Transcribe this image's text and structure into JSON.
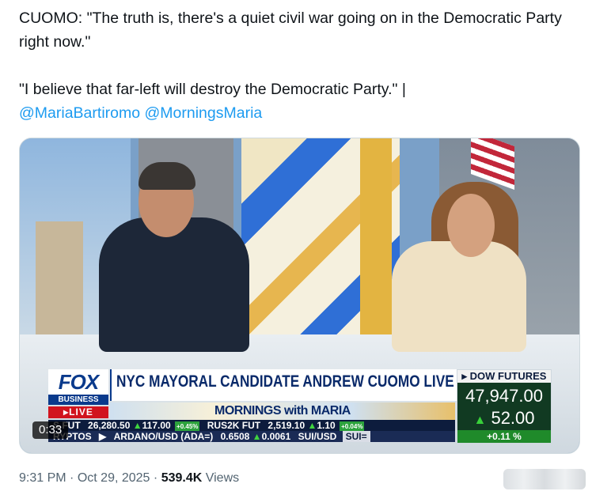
{
  "tweet": {
    "line1": "CUOMO: \"The truth is, there's a quiet civil war going on in the Democratic Party right now.\"",
    "line2_text": "\"I believe that far-left will destroy the Democratic Party.\" |",
    "mention1": "@MariaBartiromo",
    "mention2": "@MorningsMaria"
  },
  "video": {
    "timestamp": "0:33",
    "logo": {
      "fox": "FOX",
      "business": "BUSINESS",
      "live": "LIVE"
    },
    "headline": "NYC MAYORAL CANDIDATE ANDREW CUOMO LIVE ON MWM",
    "show_title": "MORNINGS with MARIA",
    "ticker_row1": [
      {
        "label": "S FUT",
        "value": "26,280.50",
        "change": "117.00",
        "pct": "+0.45%"
      },
      {
        "label": "RUS2K FUT",
        "value": "2,519.10",
        "change": "1.10",
        "pct": "+0.04%"
      }
    ],
    "ticker_row2": [
      {
        "label": "RYPTOS"
      },
      {
        "label": "ARDANO/USD (ADA=)",
        "value": "0.6508",
        "change": "0.0061"
      },
      {
        "label": "SUI/USD",
        "badge": "SUI="
      }
    ],
    "dow": {
      "title": "DOW FUTURES",
      "value": "47,947.00",
      "change": "52.00",
      "pct": "+0.11 %"
    }
  },
  "meta": {
    "time": "9:31 PM",
    "separator": "·",
    "date": "Oct 29, 2025",
    "views_count": "539.4K",
    "views_label": "Views"
  },
  "colors": {
    "link": "#1d9bf0",
    "text": "#0f1419",
    "muted": "#536471"
  }
}
